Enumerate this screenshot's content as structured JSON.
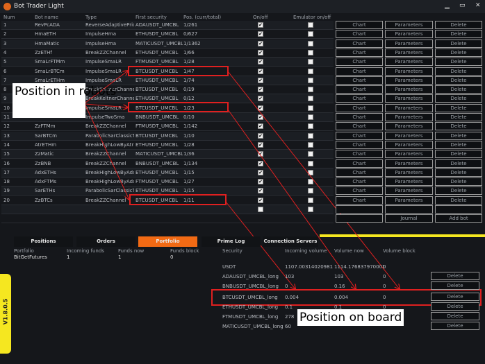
{
  "window": {
    "title": "Bot Trader Light",
    "minimize": "▁",
    "maximize": "▭",
    "close": "✕"
  },
  "bots": {
    "headers": [
      "Num",
      "Bot name",
      "Type",
      "First security",
      "Pos. (curr/total)",
      "On/off",
      "Emulator on/off"
    ],
    "rows": [
      [
        "1",
        "RevPcADA",
        "ReverseAdaptivePriceC",
        "ADAUSDT_UMCBL",
        "1/261"
      ],
      [
        "2",
        "HmaETH",
        "ImpulseHma",
        "ETHUSDT_UMCBL",
        "0/627"
      ],
      [
        "3",
        "HmaMatic",
        "ImpulseHma",
        "MATICUSDT_UMCBL",
        "1/1362"
      ],
      [
        "4",
        "ZzETHf",
        "BreakZZChannel",
        "ETHUSDT_UMCBL",
        "1/66"
      ],
      [
        "5",
        "SmaLrFTMm",
        "ImpulseSmaLR",
        "FTMUSDT_UMCBL",
        "1/28"
      ],
      [
        "6",
        "SmaLrBTCm",
        "ImpulseSmaLR",
        "BTCUSDT_UMCBL",
        "1/47"
      ],
      [
        "7",
        "SmaLrETHm",
        "ImpulseSmaLR",
        "ETHUSDT_UMCBL",
        "1/74"
      ],
      [
        "8",
        "",
        "BreakKeltnerChannels",
        "BTCUSDT_UMCBL",
        "0/19"
      ],
      [
        "9",
        "",
        "BreakKeltnerChannels",
        "ETHUSDT_UMCBL",
        "0/12"
      ],
      [
        "10",
        "",
        "ImpulseSmaLR",
        "BTCUSDT_UMCBL",
        "1/23"
      ],
      [
        "11",
        "",
        "ImpulseTwoSma",
        "BNBUSDT_UMCBL",
        "0/10"
      ],
      [
        "12",
        "ZzFTMm",
        "BreakZZChannel",
        "FTMUSDT_UMCBL",
        "1/142"
      ],
      [
        "13",
        "SarBTCm",
        "ParabolicSarClassicTrai",
        "BTCUSDT_UMCBL",
        "1/10"
      ],
      [
        "14",
        "AtrETHm",
        "BreakHighLowByAtrExt",
        "ETHUSDT_UMCBL",
        "1/28"
      ],
      [
        "15",
        "ZzMatic",
        "BreakZZChannel",
        "MATICUSDT_UMCBL",
        "1/36"
      ],
      [
        "16",
        "ZzBNB",
        "BreakZZChannel",
        "BNBUSDT_UMCBL",
        "1/134"
      ],
      [
        "17",
        "AdxETHs",
        "BreakHighLowByAdx",
        "ETHUSDT_UMCBL",
        "1/15"
      ],
      [
        "18",
        "AdxFTMs",
        "BreakHighLowByAdx",
        "FTMUSDT_UMCBL",
        "1/27"
      ],
      [
        "19",
        "SarETHs",
        "ParabolicSarClassicTrai",
        "ETHUSDT_UMCBL",
        "1/15"
      ],
      [
        "20",
        "ZzBTCs",
        "BreakZZChannel",
        "BTCUSDT_UMCBL",
        "1/11"
      ]
    ],
    "on_off": true,
    "emulator": false,
    "chart_label": "Chart",
    "params_label": "Parameters",
    "delete_label": "Delete",
    "journal_label": "Journal",
    "add_bot_label": "Add bot"
  },
  "tabs": [
    "Positions",
    "Orders",
    "Portfolio",
    "Prime Log",
    "Connection Servers"
  ],
  "active_tab": "Portfolio",
  "portfolio": {
    "headers": [
      "Portfolio",
      "Incoming funds",
      "Funds now",
      "Funds block"
    ],
    "row": [
      "BitGetFutures",
      "1",
      "1",
      "0"
    ]
  },
  "securities": {
    "headers": [
      "Security",
      "Incoming volume",
      "Volume now",
      "Volume block"
    ],
    "rows": [
      [
        "USDT",
        "1107.00314020981",
        "1114.176837970001",
        "0",
        false
      ],
      [
        "ADAUSDT_UMCBL_long",
        "103",
        "103",
        "0",
        true
      ],
      [
        "BNBUSDT_UMCBL_long",
        "0",
        "0.16",
        "0",
        true
      ],
      [
        "BTCUSDT_UMCBL_long",
        "0.004",
        "0.004",
        "0",
        true
      ],
      [
        "ETHUSDT_UMCBL_long",
        "0.1",
        "0.1",
        "0",
        true
      ],
      [
        "FTMUSDT_UMCBL_long",
        "278",
        "",
        "",
        true
      ],
      [
        "MATICUSDT_UMCBL_long",
        "60",
        "",
        "",
        true
      ]
    ],
    "delete_label": "Delete"
  },
  "version": "V1.8.0.5",
  "annotations": {
    "robots": "Position in robots",
    "board": "Position on board",
    "color": "#e02020"
  },
  "colors": {
    "accent": "#f26a14",
    "yellow": "#f5e720"
  }
}
